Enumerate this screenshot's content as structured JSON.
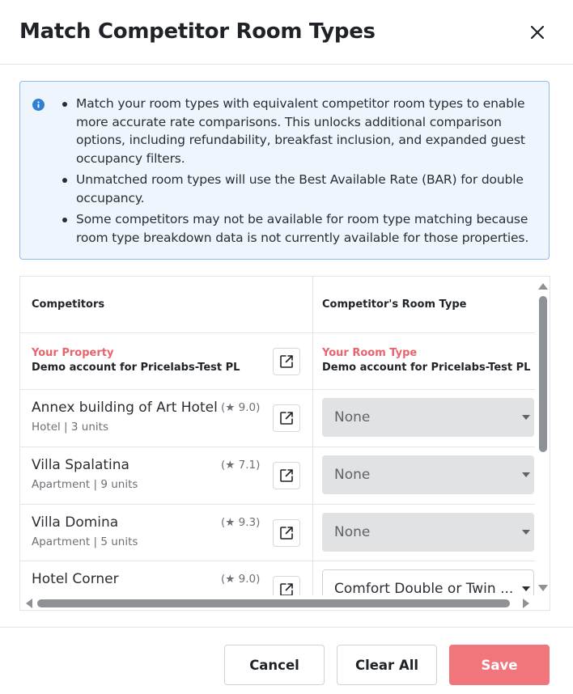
{
  "modal": {
    "title": "Match Competitor Room Types"
  },
  "info": {
    "items": [
      "Match your room types with equivalent competitor room types to enable more accurate rate comparisons. This unlocks additional comparison options, including refundability, breakfast inclusion, and expanded guest occupancy filters.",
      "Unmatched room types will use the Best Available Rate (BAR) for double occupancy.",
      "Some competitors may not be available for room type matching because room type breakdown data is not currently available for those properties."
    ]
  },
  "table": {
    "headers": {
      "competitors": "Competitors",
      "room_type": "Competitor's Room Type"
    },
    "own": {
      "property_label": "Your Property",
      "property_name": "Demo account for Pricelabs-Test PL",
      "room_type_label": "Your Room Type",
      "room_type_name": "Demo account for Pricelabs-Test PL"
    },
    "rows": [
      {
        "name": "Annex building of Art Hotel",
        "rating": "(★ 9.0)",
        "rating_value": "9.0",
        "type": "Hotel",
        "units": "3 units",
        "selection": "None",
        "disabled": true
      },
      {
        "name": "Villa Spalatina",
        "rating": "(★ 7.1)",
        "rating_value": "7.1",
        "type": "Apartment",
        "units": "9 units",
        "selection": "None",
        "disabled": true
      },
      {
        "name": "Villa Domina",
        "rating": "(★ 9.3)",
        "rating_value": "9.3",
        "type": "Apartment",
        "units": "5 units",
        "selection": "None",
        "disabled": true
      },
      {
        "name": "Hotel Corner",
        "rating": "(★ 9.0)",
        "rating_value": "9.0",
        "type": "",
        "units": "",
        "selection": "Comfort Double or Twin ...",
        "disabled": false
      }
    ]
  },
  "footer": {
    "cancel_label": "Cancel",
    "clear_label": "Clear All",
    "save_label": "Save"
  },
  "colors": {
    "accent": "#f0767c",
    "own_label": "#e8636c",
    "info_bg": "#eef5fd",
    "info_icon": "#2f7fd3"
  }
}
